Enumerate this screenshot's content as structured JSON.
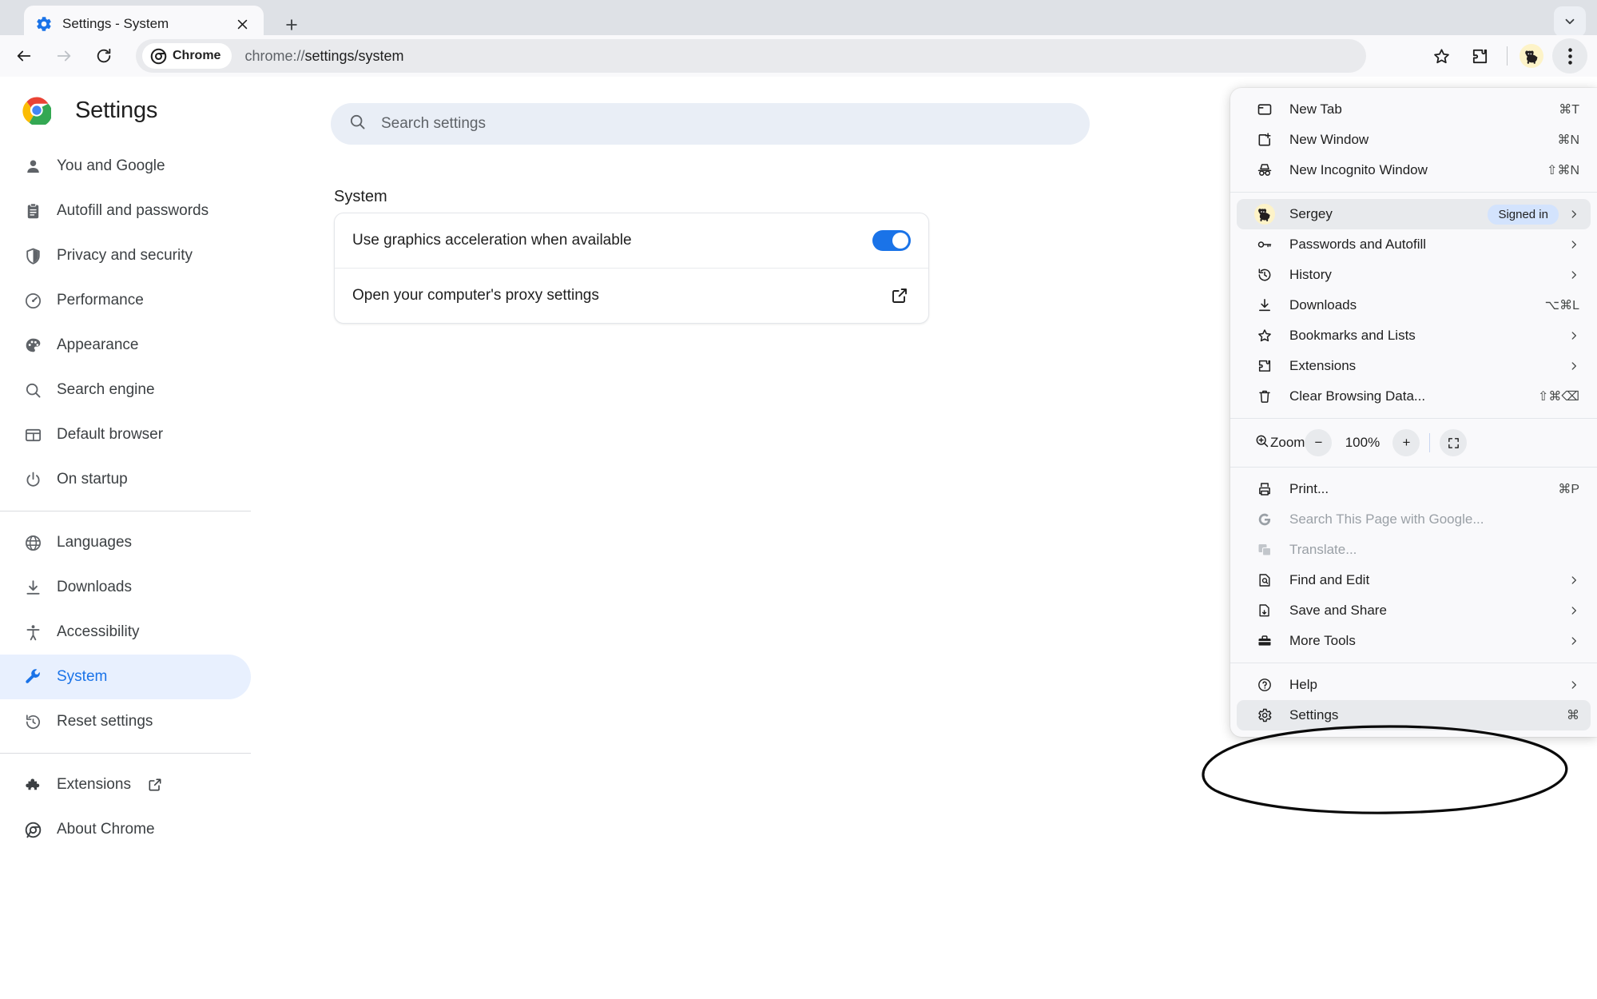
{
  "tabstrip": {
    "tab": {
      "title": "Settings - System",
      "favicon_icon": "gear-icon",
      "close_icon": "close-icon"
    },
    "new_tab_icon": "plus-icon",
    "tab_search_icon": "chevron-down-icon"
  },
  "toolbar": {
    "back_icon": "arrow-back-icon",
    "forward_icon": "arrow-forward-icon",
    "reload_icon": "reload-icon",
    "chip_label": "Chrome",
    "chip_icon": "chrome-icon",
    "url_prefix": "chrome://",
    "url_path": "settings/system",
    "bookmark_icon": "star-icon",
    "extensions_icon": "puzzle-piece-icon",
    "avatar_icon": "dog-avatar-icon",
    "menu_icon": "three-dot-menu-icon"
  },
  "sidebar": {
    "brand_title": "Settings",
    "brand_icon": "chrome-logo-icon",
    "groups": [
      {
        "items": [
          {
            "label": "You and Google",
            "icon": "person-icon",
            "active": false
          },
          {
            "label": "Autofill and passwords",
            "icon": "clipboard-icon",
            "active": false
          },
          {
            "label": "Privacy and security",
            "icon": "shield-icon",
            "active": false
          },
          {
            "label": "Performance",
            "icon": "speedometer-icon",
            "active": false
          },
          {
            "label": "Appearance",
            "icon": "palette-icon",
            "active": false
          },
          {
            "label": "Search engine",
            "icon": "search-icon",
            "active": false
          },
          {
            "label": "Default browser",
            "icon": "browser-window-icon",
            "active": false
          },
          {
            "label": "On startup",
            "icon": "power-icon",
            "active": false
          }
        ]
      },
      {
        "items": [
          {
            "label": "Languages",
            "icon": "globe-icon",
            "active": false
          },
          {
            "label": "Downloads",
            "icon": "download-icon",
            "active": false
          },
          {
            "label": "Accessibility",
            "icon": "accessibility-icon",
            "active": false
          },
          {
            "label": "System",
            "icon": "wrench-icon",
            "active": true
          },
          {
            "label": "Reset settings",
            "icon": "restore-icon",
            "active": false
          }
        ]
      },
      {
        "items": [
          {
            "label": "Extensions",
            "icon": "puzzle-piece-icon",
            "active": false,
            "external": true
          },
          {
            "label": "About Chrome",
            "icon": "chrome-icon",
            "active": false
          }
        ]
      }
    ]
  },
  "content": {
    "search": {
      "placeholder": "Search settings",
      "icon": "search-icon"
    },
    "section_title": "System",
    "rows": [
      {
        "label": "Use graphics acceleration when available",
        "control": "toggle",
        "toggle_on": true
      },
      {
        "label": "Open your computer's proxy settings",
        "control": "external-link",
        "icon": "open-in-new-icon"
      }
    ]
  },
  "appmenu": {
    "groups": [
      {
        "items": [
          {
            "label": "New Tab",
            "icon": "new-tab-icon",
            "accel": "⌘T"
          },
          {
            "label": "New Window",
            "icon": "new-window-icon",
            "accel": "⌘N"
          },
          {
            "label": "New Incognito Window",
            "icon": "incognito-icon",
            "accel": "⇧⌘N"
          }
        ]
      },
      {
        "items": [
          {
            "label": "Sergey",
            "icon": "dog-avatar-icon",
            "badge": "Signed in",
            "submenu": true,
            "highlight": true
          },
          {
            "label": "Passwords and Autofill",
            "icon": "key-icon",
            "submenu": true
          },
          {
            "label": "History",
            "icon": "history-icon",
            "submenu": true
          },
          {
            "label": "Downloads",
            "icon": "download-icon",
            "accel": "⌥⌘L"
          },
          {
            "label": "Bookmarks and Lists",
            "icon": "star-icon",
            "submenu": true
          },
          {
            "label": "Extensions",
            "icon": "puzzle-piece-icon",
            "submenu": true
          },
          {
            "label": "Clear Browsing Data...",
            "icon": "trash-icon",
            "accel": "⇧⌘⌫"
          }
        ]
      },
      {
        "zoom": {
          "label": "Zoom",
          "icon": "zoom-in-icon",
          "minus_label": "−",
          "value": "100%",
          "plus_label": "+",
          "fullscreen_icon": "fullscreen-icon"
        }
      },
      {
        "items": [
          {
            "label": "Print...",
            "icon": "print-icon",
            "accel": "⌘P"
          },
          {
            "label": "Search This Page with Google...",
            "icon": "google-g-icon",
            "disabled": true
          },
          {
            "label": "Translate...",
            "icon": "translate-icon",
            "disabled": true
          },
          {
            "label": "Find and Edit",
            "icon": "find-icon",
            "submenu": true
          },
          {
            "label": "Save and Share",
            "icon": "save-share-icon",
            "submenu": true
          },
          {
            "label": "More Tools",
            "icon": "toolbox-icon",
            "submenu": true
          }
        ]
      },
      {
        "items": [
          {
            "label": "Help",
            "icon": "help-icon",
            "submenu": true
          },
          {
            "label": "Settings",
            "icon": "gear-icon",
            "accel": "⌘",
            "highlight": true
          }
        ]
      }
    ]
  },
  "annotation": {
    "shape": "ellipse",
    "color": "#000000",
    "target": "Settings"
  }
}
